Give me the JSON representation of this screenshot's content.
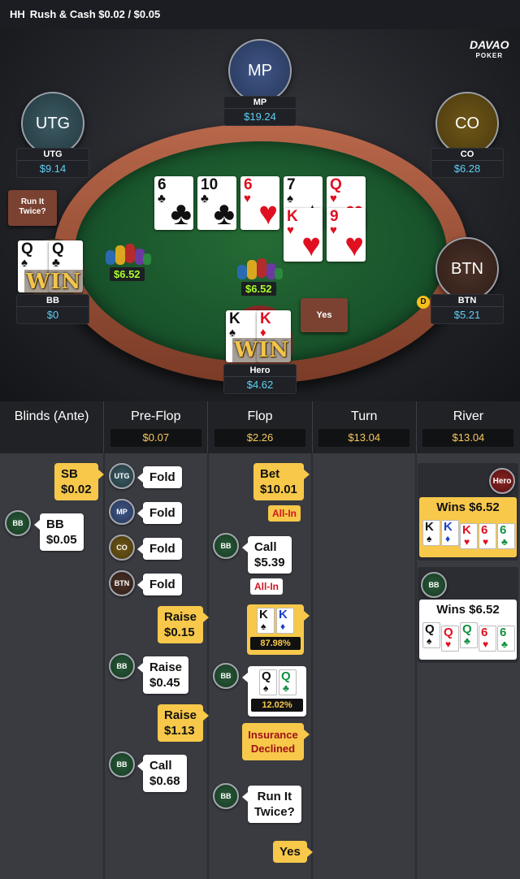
{
  "header": {
    "hh": "HH",
    "game": "Rush & Cash $0.02 / $0.05"
  },
  "brand": {
    "name": "DAVAO",
    "sub": "POKER"
  },
  "seats": {
    "mp": {
      "label": "MP",
      "name": "MP",
      "stack": "$19.24"
    },
    "utg": {
      "label": "UTG",
      "name": "UTG",
      "stack": "$9.14"
    },
    "co": {
      "label": "CO",
      "name": "CO",
      "stack": "$6.28"
    },
    "btn": {
      "label": "BTN",
      "name": "BTN",
      "stack": "$5.21"
    },
    "bb": {
      "name": "BB",
      "stack": "$0"
    },
    "hero": {
      "name": "Hero",
      "stack": "$4.62"
    }
  },
  "table": {
    "run_it_twice_btn": "Run It Twice?",
    "yes_btn": "Yes",
    "dealer_button": "D",
    "pot_left": "$6.52",
    "pot_center": "$6.52",
    "win_text": "WIN",
    "board1": [
      {
        "r": "6",
        "s": "♣"
      },
      {
        "r": "10",
        "s": "♣"
      },
      {
        "r": "6",
        "s": "♥"
      },
      {
        "r": "7",
        "s": "♠"
      },
      {
        "r": "Q",
        "s": "♥"
      }
    ],
    "board2": [
      {
        "r": "K",
        "s": "♥"
      },
      {
        "r": "9",
        "s": "♥"
      }
    ],
    "bb_cards": [
      {
        "r": "Q",
        "s": "♠"
      },
      {
        "r": "Q",
        "s": "♣"
      }
    ],
    "hero_cards": [
      {
        "r": "K",
        "s": "♠"
      },
      {
        "r": "K",
        "s": "♦"
      }
    ]
  },
  "streets": [
    {
      "name": "Blinds (Ante)",
      "pot": ""
    },
    {
      "name": "Pre-Flop",
      "pot": "$0.07"
    },
    {
      "name": "Flop",
      "pot": "$2.26"
    },
    {
      "name": "Turn",
      "pot": "$13.04"
    },
    {
      "name": "River",
      "pot": "$13.04"
    }
  ],
  "history": {
    "blinds": {
      "sb": "SB\n$0.02",
      "bb_av": "BB",
      "bb": "BB\n$0.05"
    },
    "preflop": {
      "utg_av": "UTG",
      "utg": "Fold",
      "mp_av": "MP",
      "mp": "Fold",
      "co_av": "CO",
      "co": "Fold",
      "btn_av": "BTN",
      "btn": "Fold",
      "raise1": "Raise\n$0.15",
      "bb_av1": "BB",
      "raise2": "Raise\n$0.45",
      "raise3": "Raise\n$1.13",
      "bb_av2": "BB",
      "call": "Call\n$0.68"
    },
    "flop": {
      "bet": "Bet\n$10.01",
      "allin1": "All-In",
      "bb_av1": "BB",
      "call": "Call\n$5.39",
      "allin2": "All-In",
      "hero_cards": [
        {
          "r": "K",
          "s": "♠"
        },
        {
          "r": "K",
          "s": "♦"
        }
      ],
      "hero_eq": "87.98%",
      "bb_av2": "BB",
      "bb_cards": [
        {
          "r": "Q",
          "s": "♠"
        },
        {
          "r": "Q",
          "s": "♣"
        }
      ],
      "bb_eq": "12.02%",
      "insurance": "Insurance\nDeclined",
      "bb_av3": "BB",
      "rit": "Run It\nTwice?",
      "yes": "Yes"
    },
    "river": {
      "hero_av": "Hero",
      "hero_wins": "Wins $6.52",
      "hero_hand": [
        {
          "r": "K",
          "s": "♠"
        },
        {
          "r": "K",
          "s": "♦"
        },
        {
          "r": "K",
          "s": "♥"
        },
        {
          "r": "6",
          "s": "♥"
        },
        {
          "r": "6",
          "s": "♣"
        }
      ],
      "bb_av": "BB",
      "bb_wins": "Wins $6.52",
      "bb_hand": [
        {
          "r": "Q",
          "s": "♠"
        },
        {
          "r": "Q",
          "s": "♥"
        },
        {
          "r": "Q",
          "s": "♣"
        },
        {
          "r": "6",
          "s": "♥"
        },
        {
          "r": "6",
          "s": "♣"
        }
      ]
    }
  },
  "colors": {
    "accent_yellow": "#f7c84a",
    "stack_blue": "#5fd0f5",
    "pot_green": "#a8ff2c",
    "felt": "#1d5f30",
    "rail": "#9a5034"
  }
}
